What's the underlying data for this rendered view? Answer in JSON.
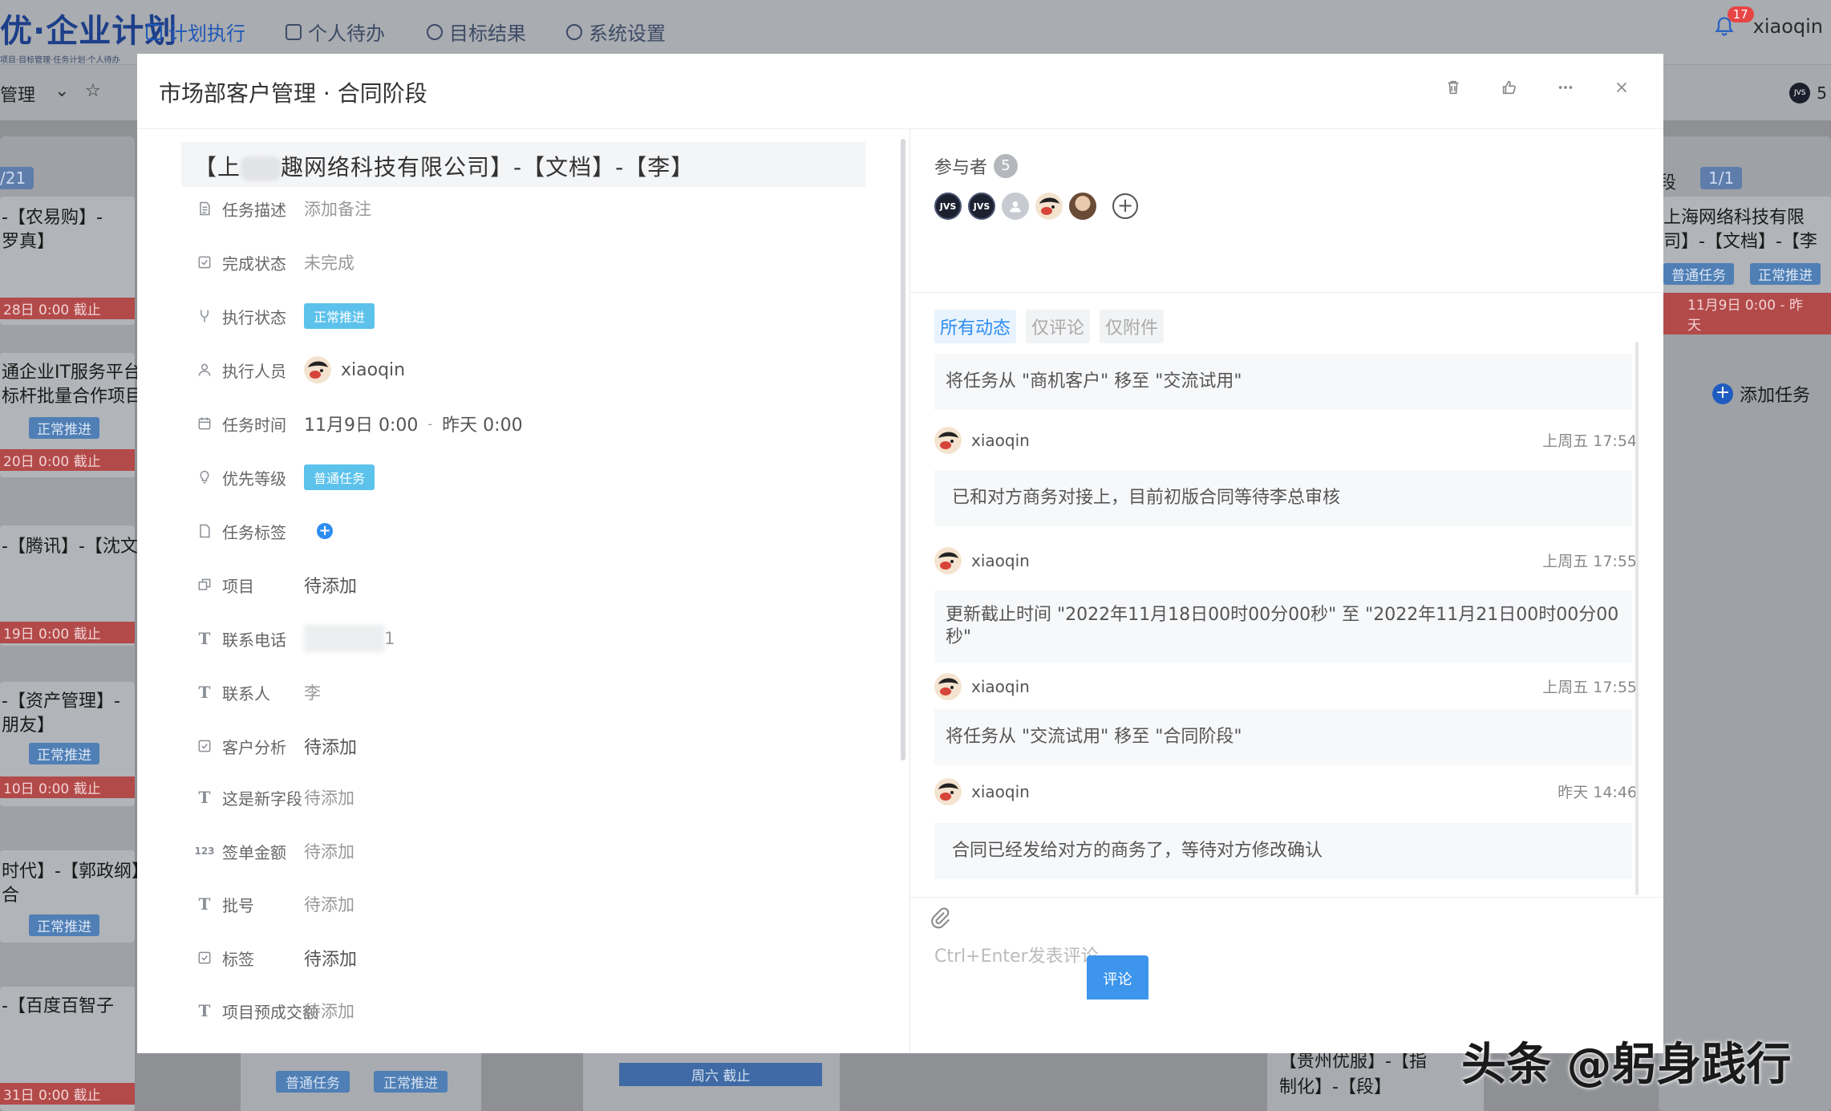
{
  "app": {
    "logo_text": "优·企业计划",
    "logo_sub": "项目·目标管理·任务计划·个人待办",
    "nav": [
      {
        "label": "计划执行",
        "active": true
      },
      {
        "label": "个人待办",
        "active": false
      },
      {
        "label": "目标结果",
        "active": false
      },
      {
        "label": "系统设置",
        "active": false
      }
    ],
    "notification_count": "17",
    "username": "xiaoqin",
    "subbar_title": "管理",
    "subbar_right_count": "5"
  },
  "board_bg": {
    "left_badge": "/21",
    "right_badge": "1/1",
    "right_col_title": "段",
    "left_cards": [
      {
        "text": "-【农易购】-\n罗真】",
        "due": "28日 0:00 截止"
      },
      {
        "text": "通企业IT服务平台\n标杆批量合作项目",
        "tag": "正常推进",
        "due": "20日 0:00 截止"
      },
      {
        "text": "-【腾讯】-【沈文",
        "due": "19日 0:00 截止"
      },
      {
        "text": "-【资产管理】-\n朋友】",
        "tag": "正常推进",
        "due": "10日 0:00 截止"
      },
      {
        "text": "时代】-【郭政纲】\n合",
        "tag": "正常推进"
      },
      {
        "text": "-【百度百智子",
        "due": "31日 0:00 截止"
      }
    ],
    "right_card": {
      "text": "上海网络科技有限\n司】-【文档】-【李",
      "tags": [
        "普通任务",
        "正常推进"
      ],
      "due": "11月9日 0:00 - 昨天"
    },
    "add_task": "添加任务",
    "bottom_tags": [
      "普通任务",
      "正常推进"
    ],
    "bottom_due": "周六 截止",
    "bottom_right_text": "【贵州优服】-【指\n制化】-【段】"
  },
  "modal": {
    "title": "市场部客户管理 · 合同阶段",
    "task_title_prefix": "【上",
    "task_title_suffix": "趣网络科技有限公司】-【文档】-【李】",
    "fields": [
      {
        "label": "任务描述",
        "value": "添加备注",
        "icon": "description-icon"
      },
      {
        "label": "完成状态",
        "value": "未完成",
        "icon": "checkbox-icon"
      },
      {
        "label": "执行状态",
        "value": "正常推进",
        "icon": "branch-icon",
        "pill": true
      },
      {
        "label": "执行人员",
        "value": "xiaoqin",
        "icon": "user-icon",
        "avatar": true
      },
      {
        "label": "任务时间",
        "value": "11月9日 0:00",
        "value2": "昨天 0:00",
        "icon": "calendar-icon"
      },
      {
        "label": "优先等级",
        "value": "普通任务",
        "icon": "bulb-icon",
        "pill": true
      },
      {
        "label": "任务标签",
        "value": "",
        "icon": "tag-icon",
        "plus": true
      },
      {
        "label": "项目",
        "value": "待添加",
        "icon": "project-icon"
      },
      {
        "label": "联系电话",
        "value": "1",
        "icon": "text-icon",
        "blur": true
      },
      {
        "label": "联系人",
        "value": "李",
        "icon": "text-icon"
      },
      {
        "label": "客户分析",
        "value": "待添加",
        "icon": "checkbox-icon"
      },
      {
        "label": "这是新字段",
        "value": "待添加",
        "icon": "text-icon"
      },
      {
        "label": "签单金额",
        "value": "待添加",
        "icon": "number-icon"
      },
      {
        "label": "批号",
        "value": "待添加",
        "icon": "text-icon"
      },
      {
        "label": "标签",
        "value": "待添加",
        "icon": "checkbox-icon"
      },
      {
        "label": "项目预成交额",
        "value": "待添加",
        "icon": "text-icon"
      }
    ],
    "participants_label": "参与者",
    "participants_count": "5",
    "jvs_label": "JVS",
    "filters": [
      "所有动态",
      "仅评论",
      "仅附件"
    ],
    "feed": [
      {
        "type": "msg",
        "text": "将任务从 \"商机客户\" 移至 \"交流试用\""
      },
      {
        "type": "user",
        "name": "xiaoqin",
        "time": "上周五 17:54"
      },
      {
        "type": "msg",
        "text": "已和对方商务对接上，目前初版合同等待李总审核"
      },
      {
        "type": "user",
        "name": "xiaoqin",
        "time": "上周五 17:55"
      },
      {
        "type": "msg",
        "text": "更新截止时间 \"2022年11月18日00时00分00秒\" 至 \"2022年11月21日00时00分00秒\""
      },
      {
        "type": "user",
        "name": "xiaoqin",
        "time": "上周五 17:55"
      },
      {
        "type": "msg",
        "text": "将任务从 \"交流试用\" 移至 \"合同阶段\""
      },
      {
        "type": "user",
        "name": "xiaoqin",
        "time": "昨天 14:46"
      },
      {
        "type": "msg",
        "text": "合同已经发给对方的商务了，等待对方修改确认"
      }
    ],
    "composer_placeholder": "Ctrl+Enter发表评论",
    "submit_label": "评论"
  },
  "watermark": "头条 @躬身践行"
}
